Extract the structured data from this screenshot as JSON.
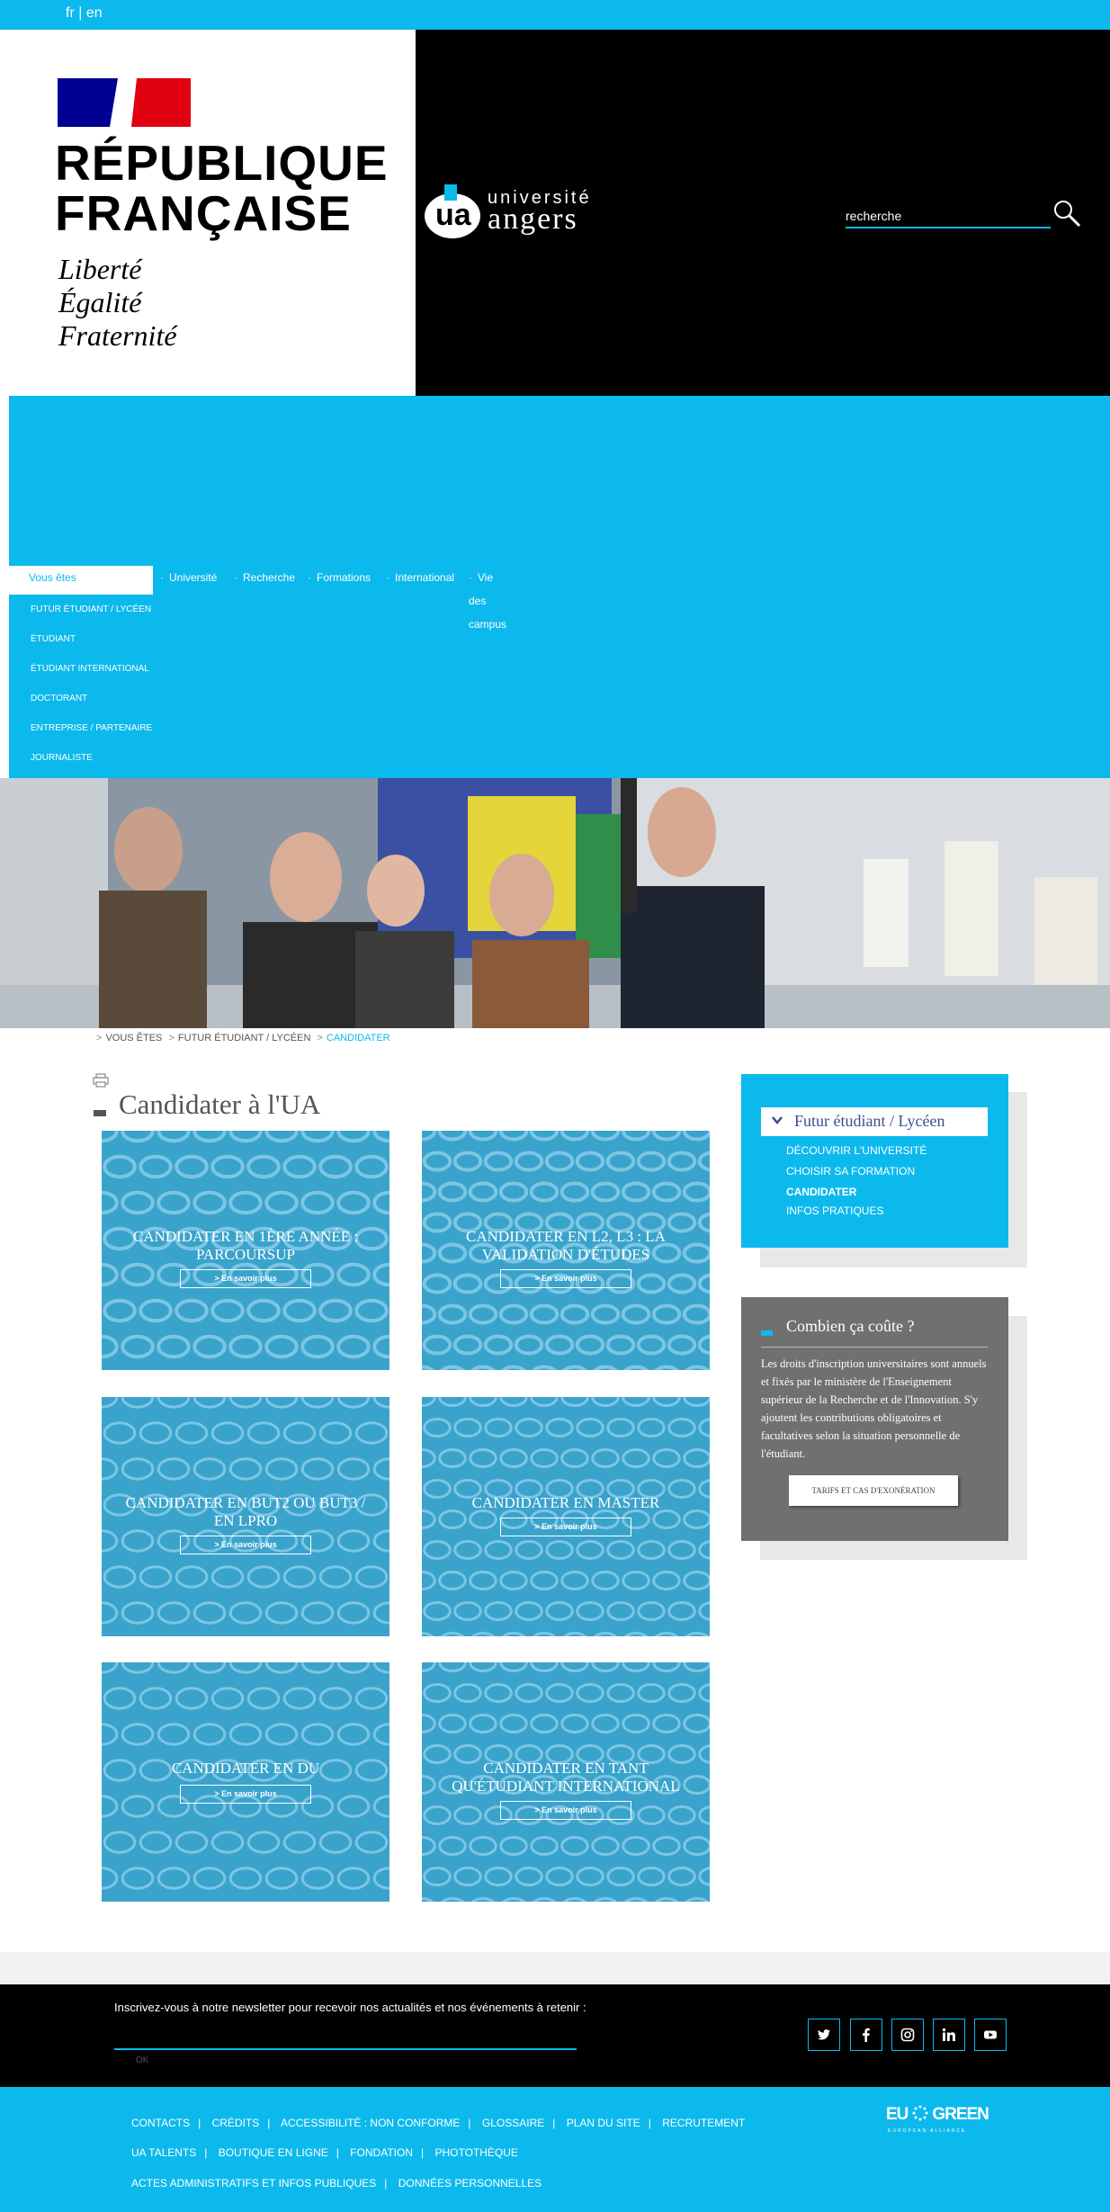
{
  "lang": {
    "fr": "fr",
    "sep": "|",
    "en": "en"
  },
  "rf": {
    "title_line1": "RÉPUBLIQUE",
    "title_line2": "FRANÇAISE",
    "motto_1": "Liberté",
    "motto_2": "Égalité",
    "motto_3": "Fraternité"
  },
  "ua_logo": {
    "mark": "ua",
    "line1": "université",
    "line2": "angers"
  },
  "search": {
    "placeholder": "recherche"
  },
  "nav": {
    "tabs": [
      {
        "label": "Vous êtes"
      },
      {
        "label": "Université"
      },
      {
        "label": "Recherche"
      },
      {
        "label": "Formations"
      },
      {
        "label": "International"
      },
      {
        "label": "Vie des campus"
      }
    ],
    "vous_menu": [
      "Futur étudiant / Lycéen",
      "Étudiant",
      "Étudiant international",
      "Doctorant",
      "Entreprise / Partenaire",
      "Journaliste"
    ]
  },
  "breadcrumb": {
    "item1": "Vous êtes",
    "item2": "Futur étudiant / Lycéen",
    "current": "Candidater",
    "sep": ">"
  },
  "page_title": "Candidater à l'UA",
  "tiles": [
    {
      "title": "Candidater en 1ère année : Parcoursup",
      "more": "> En savoir plus"
    },
    {
      "title": "Candidater en L2, L3 : la validation d'études",
      "more": "> En savoir plus"
    },
    {
      "title": "Candidater en BUT2 ou BUT3 / en LPro",
      "more": "> En savoir plus"
    },
    {
      "title": "Candidater en Master",
      "more": "> En savoir plus"
    },
    {
      "title": "Candidater en DU",
      "more": "> En savoir plus"
    },
    {
      "title": "Candidater en tant qu'étudiant international",
      "more": "> En savoir plus"
    }
  ],
  "side_nav": {
    "heading": "Futur étudiant / Lycéen",
    "links": [
      "Découvrir l'université",
      "Choisir sa formation",
      "Candidater",
      "Infos pratiques"
    ],
    "active": "Candidater"
  },
  "cost": {
    "title": "Combien ça coûte ?",
    "text": "Les droits d'inscription universitaires sont annuels et fixés par le ministère de l'Enseignement supérieur de la Recherche et de l'Innovation. S'y ajoutent les contributions obligatoires et facultatives selon la situation personnelle de l'étudiant.",
    "button": "Tarifs et cas d'exonération"
  },
  "newsletter": {
    "text": "Inscrivez-vous à notre newsletter pour recevoir nos actualités et nos événements à retenir :",
    "ok": "OK"
  },
  "social": [
    "twitter-icon",
    "facebook-icon",
    "instagram-icon",
    "linkedin-icon",
    "youtube-icon"
  ],
  "footer": {
    "row1": [
      "Contacts",
      "Crédits",
      "Accessibilité : non conforme",
      "Glossaire",
      "Plan du site",
      "Recrutement"
    ],
    "row2": [
      "UA Talents",
      "Boutique en ligne",
      "Fondation",
      "Photothèque"
    ],
    "row3": [
      "Actes administratifs et infos publiques",
      "Données personnelles"
    ],
    "eu_green_1": "EU",
    "eu_green_2": "GREEN",
    "eu_green_sub": "EUROPEAN ALLIANCE"
  },
  "colors": {
    "accent": "#0cb9ed",
    "tile": "#3aa3cc",
    "dark": "#000000",
    "gray_box": "#707070",
    "marianne_blue": "#000091",
    "marianne_red": "#e1000f"
  }
}
